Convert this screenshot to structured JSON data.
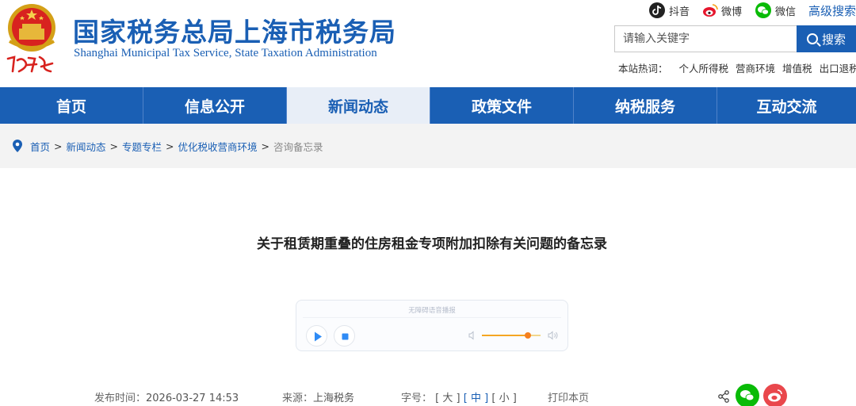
{
  "header": {
    "title": "国家税务总局上海市税务局",
    "subtitle": "Shanghai Municipal Tax Service, State Taxation Administration",
    "emblem_caption": "中国税务",
    "social": [
      {
        "label": "抖音",
        "icon": "douyin-icon",
        "color": "#222222"
      },
      {
        "label": "微博",
        "icon": "weibo-icon",
        "color": "#e6162d"
      },
      {
        "label": "微信",
        "icon": "wechat-icon",
        "color": "#09bb07"
      }
    ],
    "advanced_search": "高级搜索",
    "search": {
      "placeholder": "请输入关键字",
      "button_label": "搜索"
    },
    "hot_label": "本站热词：",
    "hot_terms": [
      "个人所得税",
      "营商环境",
      "增值税",
      "出口退税"
    ]
  },
  "nav": {
    "items": [
      "首页",
      "信息公开",
      "新闻动态",
      "政策文件",
      "纳税服务",
      "互动交流"
    ],
    "active_index": 2
  },
  "breadcrumb": {
    "links": [
      "首页",
      "新闻动态",
      "专题专栏",
      "优化税收营商环境"
    ],
    "separator": ">",
    "current": "咨询备忘录"
  },
  "article": {
    "title": "关于租赁期重叠的住房租金专项附加扣除有关问题的备忘录",
    "player": {
      "label": "无障碍语音播报",
      "volume": 0.78
    },
    "meta": {
      "publish_label": "发布时间：",
      "publish_time": "2026-03-27 14:53",
      "source_label": "来源：",
      "source": "上海税务",
      "font_label": "字号：",
      "font_sizes": [
        "大",
        "中",
        "小"
      ],
      "font_size_current": "中",
      "print_label": "打印本页"
    },
    "share": [
      {
        "icon": "wechat-share-icon",
        "color": "#09bb07"
      },
      {
        "icon": "weibo-share-icon",
        "color": "#e9474c"
      }
    ]
  },
  "colors": {
    "brand_blue": "#1a5fb4",
    "nav_active_bg": "#e8eef7",
    "crumb_bg": "#f3f3f3"
  }
}
